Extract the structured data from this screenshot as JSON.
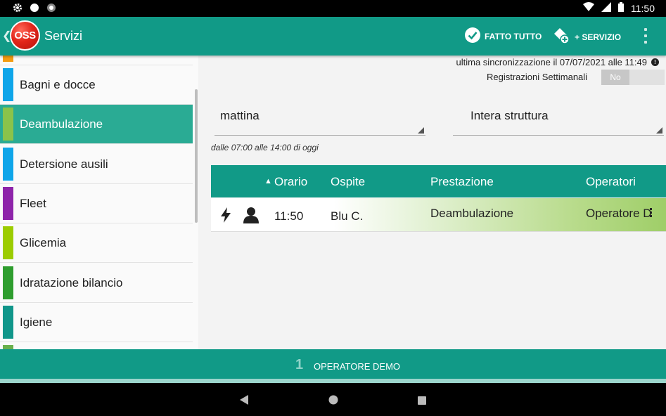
{
  "status_bar": {
    "time": "11:50",
    "left_icons": [
      "gear-icon",
      "circle-icon",
      "circle-icon"
    ],
    "right_icons": [
      "wifi-icon",
      "signal-icon",
      "battery-icon"
    ]
  },
  "app_bar": {
    "logo_text": "OSS",
    "title": "Servizi",
    "fatto_tutto_label": "FATTO TUTTO",
    "add_servizio_label": "+ SERVIZIO"
  },
  "sidebar": {
    "items": [
      {
        "label": "",
        "color": "#f39c12"
      },
      {
        "label": "Bagni e docce",
        "color": "#0ea5e9"
      },
      {
        "label": "Deambulazione",
        "color": "#8bc34a",
        "active": true
      },
      {
        "label": "Detersione ausili",
        "color": "#0ea5e9"
      },
      {
        "label": "Fleet",
        "color": "#8e24aa"
      },
      {
        "label": "Glicemia",
        "color": "#9ccc00"
      },
      {
        "label": "Idratazione bilancio",
        "color": "#2e9d2e"
      },
      {
        "label": "Igiene",
        "color": "#10968a"
      },
      {
        "label": "",
        "color": "#6ab04c"
      }
    ]
  },
  "header": {
    "sync_text": "ultima sincronizzazione il 07/07/2021 alle 11:49",
    "weekly_label": "Registrazioni Settimanali",
    "weekly_toggle": "No"
  },
  "filters": {
    "shift": "mattina",
    "scope": "Intera struttura",
    "period": "dalle 07:00 alle 14:00 di oggi"
  },
  "table": {
    "columns": [
      "Orario",
      "Ospite",
      "Prestazione",
      "Operatori"
    ],
    "sort_column": "Orario",
    "rows": [
      {
        "orario": "11:50",
        "ospite": "Blu C.",
        "prestazione": "Deambulazione",
        "operatori": "Operatore D"
      }
    ]
  },
  "bottom_bar": {
    "count": "1",
    "operator": "OPERATORE DEMO"
  },
  "colors": {
    "primary": "#119a87",
    "active_item": "#2aab94",
    "row_highlight": "#9fce68"
  }
}
